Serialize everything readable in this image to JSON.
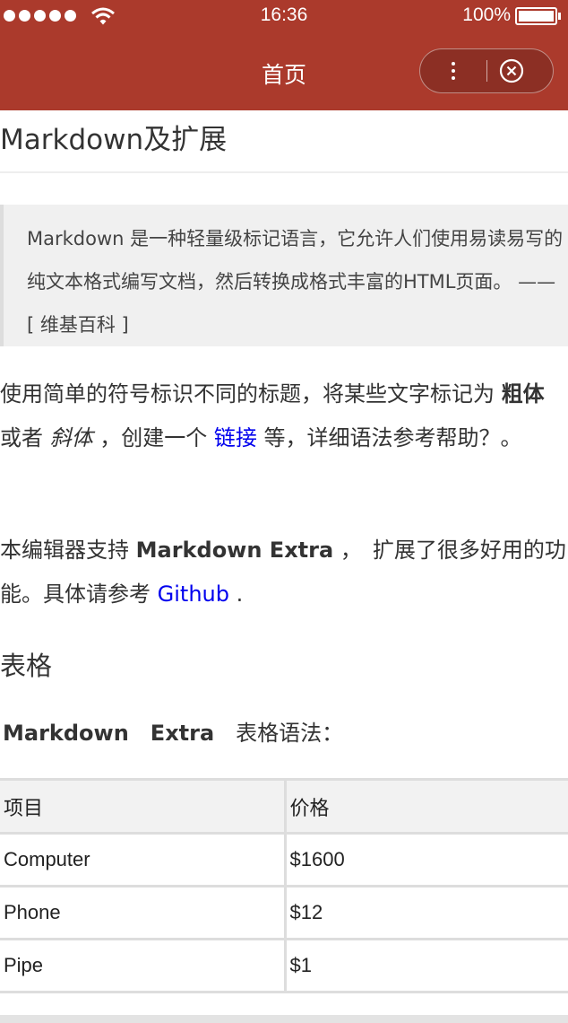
{
  "status_bar": {
    "time": "16:36",
    "battery": "100%"
  },
  "nav": {
    "title": "首页",
    "more_label": "⋮"
  },
  "article": {
    "heading": "Markdown及扩展",
    "quote": "Markdown 是一种轻量级标记语言，它允许人们使用易读易写的纯文本格式编写文档，然后转换成格式丰富的HTML页面。 —— [ 维基百科 ]",
    "para1": {
      "part1": "使用简单的符号标识不同的标题，将某些文字标记为 ",
      "bold": "粗体",
      "part2": " 或者 ",
      "italic": "斜体",
      "part3": " ，创建一个 ",
      "link": "链接",
      "part4": " 等，详细语法参考帮助？。"
    },
    "para2": {
      "part1": "本编辑器支持 ",
      "bold": "Markdown Extra",
      "part2": " ，　扩展了很多好用的功能。具体请参考 ",
      "link": "Github",
      "part3": " ."
    },
    "section_heading": "表格",
    "syntax": {
      "bold": "Markdown　Extra",
      "text": "　表格语法："
    },
    "table": {
      "headers": [
        "项目",
        "价格"
      ],
      "rows": [
        [
          "Computer",
          "$1600"
        ],
        [
          "Phone",
          "$12"
        ],
        [
          "Pipe",
          "$1"
        ]
      ]
    }
  },
  "colors": {
    "nav_background": "#ab3a2c",
    "link": "#0000ee"
  }
}
